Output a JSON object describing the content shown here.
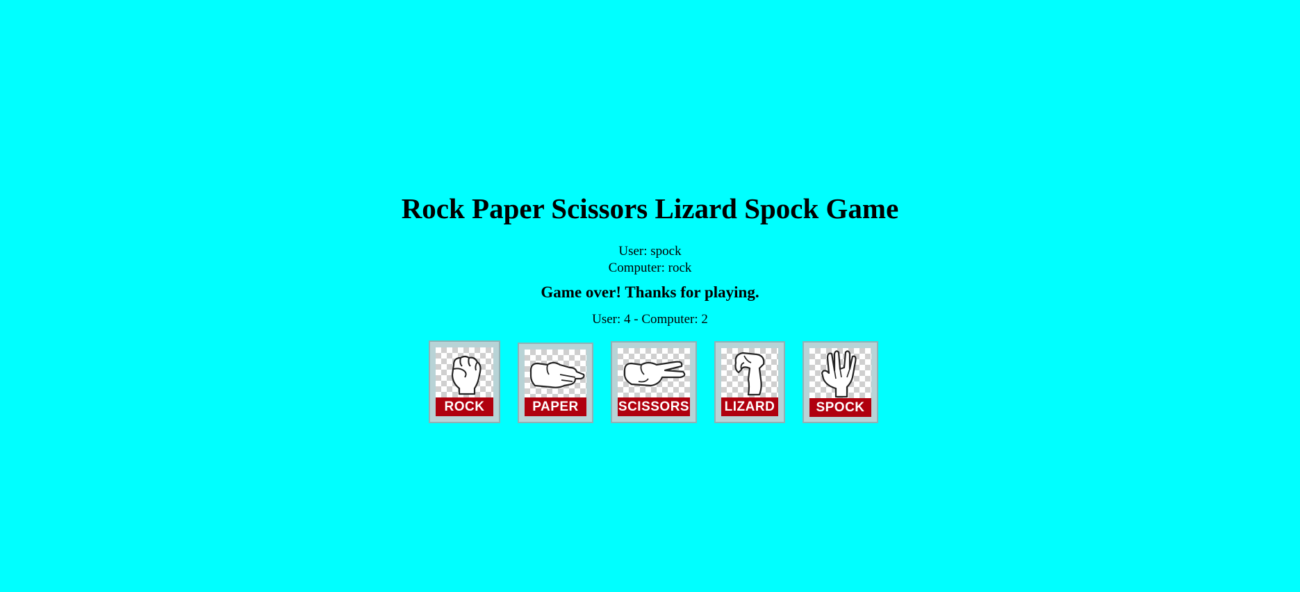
{
  "title": "Rock Paper Scissors Lizard Spock Game",
  "result": {
    "user_choice": "User: spock",
    "computer_choice": "Computer: rock",
    "status": "Game over! Thanks for playing.",
    "score": "User: 4 - Computer: 2"
  },
  "buttons": [
    {
      "label": "ROCK",
      "icon": "fist-icon"
    },
    {
      "label": "PAPER",
      "icon": "open-hand-icon"
    },
    {
      "label": "SCISSORS",
      "icon": "scissors-hand-icon"
    },
    {
      "label": "LIZARD",
      "icon": "lizard-hand-icon"
    },
    {
      "label": "SPOCK",
      "icon": "vulcan-salute-icon"
    }
  ],
  "colors": {
    "background": "#00ffff",
    "label_bar": "#b0000e"
  }
}
